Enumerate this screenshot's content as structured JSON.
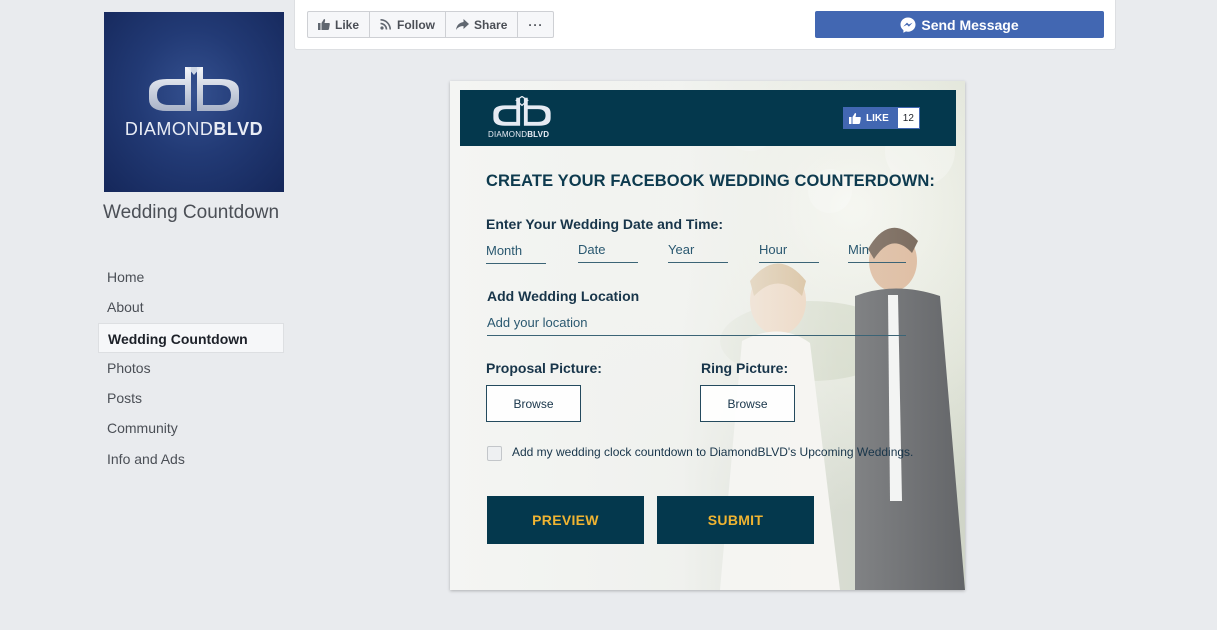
{
  "sidebar": {
    "logo_monogram": "db",
    "logo_word_light": "DIAMOND",
    "logo_word_bold": "BLVD",
    "page_name": "Wedding Countdown",
    "nav": [
      "Home",
      "About",
      "Wedding Countdown",
      "Photos",
      "Posts",
      "Community",
      "Info and Ads"
    ],
    "active_index": 2
  },
  "action_bar": {
    "like": "Like",
    "follow": "Follow",
    "share": "Share",
    "more": "···",
    "send_message": "Send Message"
  },
  "app": {
    "header_logo_light": "DIAMOND",
    "header_logo_bold": "BLVD",
    "like_label": "LIKE",
    "like_count": "12",
    "title": "CREATE YOUR FACEBOOK WEDDING COUNTERDOWN:",
    "date_label": "Enter Your Wedding Date and Time:",
    "date_fields": {
      "month": "Month",
      "date": "Date",
      "year": "Year",
      "hour": "Hour",
      "min": "Min"
    },
    "location_label": "Add Wedding Location",
    "location_placeholder": "Add your location",
    "proposal_label": "Proposal Picture:",
    "ring_label": "Ring Picture:",
    "browse": "Browse",
    "checkbox_label": "Add my wedding clock countdown to DiamondBLVD's Upcoming Weddings.",
    "checkbox_checked": false,
    "preview": "PREVIEW",
    "submit": "SUBMIT"
  },
  "colors": {
    "facebook_blue": "#4267b2",
    "app_navy": "#04384d",
    "app_gold": "#f0b432",
    "page_bg": "#e9ebee"
  }
}
